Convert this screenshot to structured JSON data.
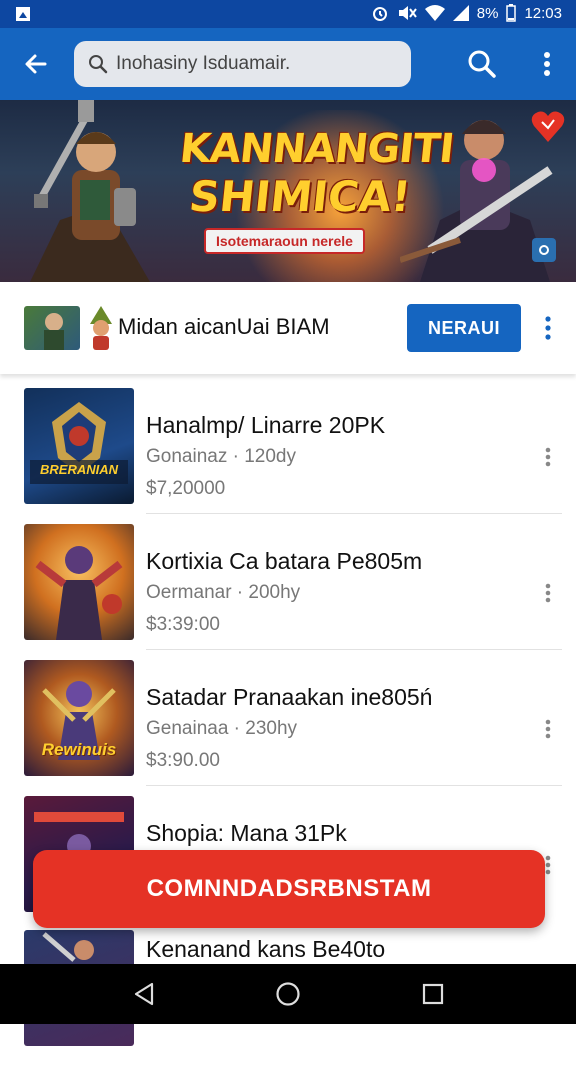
{
  "status_bar": {
    "time": "12:03",
    "battery": "8%"
  },
  "search": {
    "query": "Inohasiny Isduamair."
  },
  "banner": {
    "title_line1": "KANNANGITI",
    "title_line2": "SHIMICA!",
    "tagline": "Isotemaraoun nerele"
  },
  "promo": {
    "label": "Midan aicanUai BIAM",
    "cta_label": "NERAUI"
  },
  "items": [
    {
      "name": "Hanalmp/ Linarre 20PK",
      "meta": "Gonainaz · 120dy",
      "price": "$7,20000",
      "art_text": "BRERANIAN"
    },
    {
      "name": "Kortixia Ca batara Pe805m",
      "meta": "Oermanar · 200hy",
      "price": "$3:39:00",
      "art_text": ""
    },
    {
      "name": "Satadar Pranaakan ine805ń",
      "meta": "Genainaa · 230hy",
      "price": "$3:90.00",
      "art_text": "Rewinuis"
    },
    {
      "name": "Shopia: Mana 31Pk",
      "meta": "",
      "price": "",
      "art_text": ""
    },
    {
      "name": "Kenanand kans Be40to",
      "meta": "",
      "price": "",
      "art_text": ""
    }
  ],
  "fab": {
    "label": "COMNNDADSRBNSTAM"
  },
  "colors": {
    "app_bar": "#1565c0",
    "status_bar": "#0d47a1",
    "accent_red": "#e53225"
  },
  "icons": [
    "back-arrow-icon",
    "search-icon",
    "more-vert-icon",
    "nav-back-icon",
    "nav-home-icon",
    "nav-recents-icon"
  ]
}
